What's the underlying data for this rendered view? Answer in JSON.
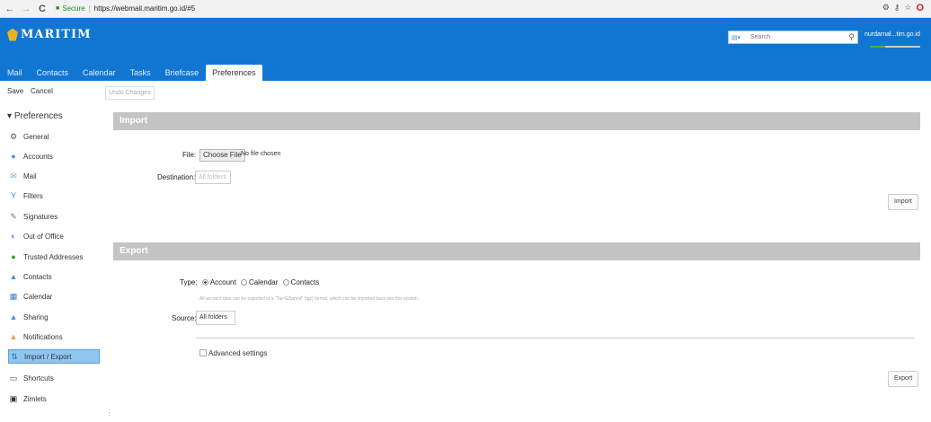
{
  "browser": {
    "back": "←",
    "forward": "→",
    "reload": "C",
    "secure_label": "Secure",
    "url_sep": "|",
    "url": "https://webmail.maritim.go.id/#5",
    "icons": [
      "star-icon",
      "opera-icon"
    ]
  },
  "app": {
    "logo_text": "MARITIM",
    "search_placeholder": "Search",
    "user": "nurdarnal...tim.go.id",
    "tabs": [
      "Mail",
      "Contacts",
      "Calendar",
      "Tasks",
      "Briefcase",
      "Preferences"
    ],
    "active_tab": "Preferences"
  },
  "toolbar": {
    "save": "Save",
    "cancel": "Cancel",
    "undo": "Undo Changes"
  },
  "sidebar": {
    "root": "Preferences",
    "items": [
      {
        "label": "General",
        "icon": "gear-icon"
      },
      {
        "label": "Accounts",
        "icon": "accounts-icon"
      },
      {
        "label": "Mail",
        "icon": "mail-icon"
      },
      {
        "label": "Filters",
        "icon": "filter-icon"
      },
      {
        "label": "Signatures",
        "icon": "signature-icon"
      },
      {
        "label": "Out of Office",
        "icon": "out-of-office-icon"
      },
      {
        "label": "Trusted Addresses",
        "icon": "trusted-icon"
      },
      {
        "label": "Contacts",
        "icon": "contacts-icon"
      },
      {
        "label": "Calendar",
        "icon": "calendar-icon"
      },
      {
        "label": "Sharing",
        "icon": "sharing-icon"
      },
      {
        "label": "Notifications",
        "icon": "notification-icon"
      },
      {
        "label": "Import / Export",
        "icon": "import-export-icon"
      },
      {
        "label": "Shortcuts",
        "icon": "shortcuts-icon"
      },
      {
        "label": "Zimlets",
        "icon": "zimlets-icon"
      }
    ],
    "selected": "Import / Export"
  },
  "import": {
    "title": "Import",
    "file_label": "File:",
    "choose_file": "Choose File",
    "no_file": "No file chosen",
    "destination_label": "Destination:",
    "destination_value": "All folders",
    "button": "Import"
  },
  "export": {
    "title": "Export",
    "type_label": "Type:",
    "types": [
      "Account",
      "Calendar",
      "Contacts"
    ],
    "selected_type": "Account",
    "hint": "All account data can be exported to a \"Tar-GZipped\" (tgz) format, which can be imported back into this system.",
    "source_label": "Source:",
    "source_value": "All folders",
    "advanced_label": "Advanced settings",
    "button": "Export"
  },
  "colors": {
    "header_blue": "#1176d1",
    "section_gray": "#c4c4c4",
    "selected_blue": "#8ec6f0"
  }
}
